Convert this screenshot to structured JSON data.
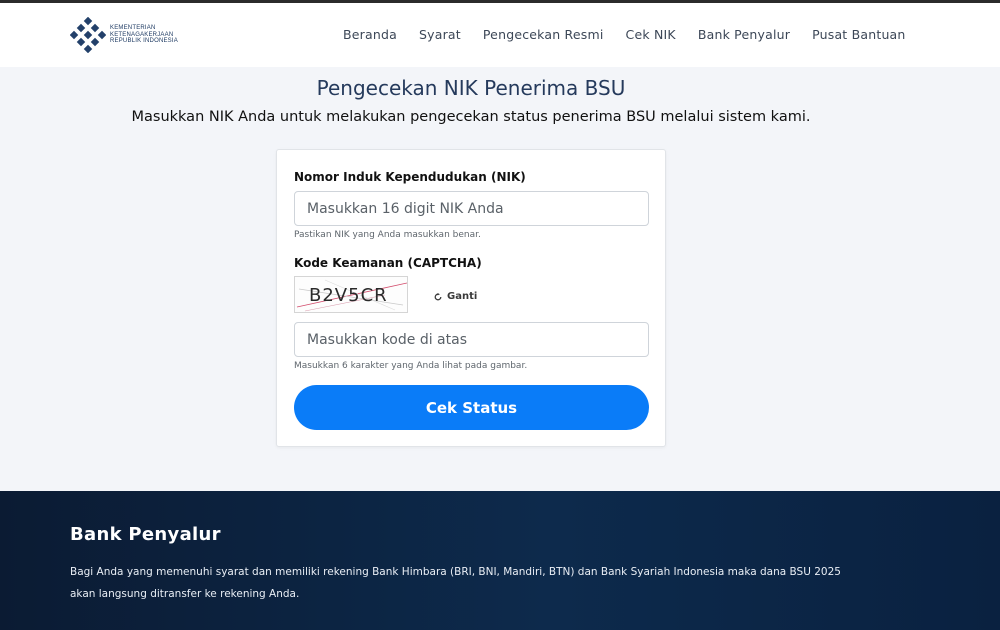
{
  "header": {
    "logo": {
      "lines": [
        "KEMENTERIAN",
        "KETENAGAKERJAAN",
        "REPUBLIK INDONESIA"
      ],
      "icon": "ministry-logo-icon"
    },
    "nav": [
      "Beranda",
      "Syarat",
      "Pengecekan Resmi",
      "Cek NIK",
      "Bank Penyalur",
      "Pusat Bantuan"
    ]
  },
  "main": {
    "title": "Pengecekan NIK Penerima BSU",
    "subtitle": "Masukkan NIK Anda untuk melakukan pengecekan status penerima BSU melalui sistem kami."
  },
  "form": {
    "nik_label": "Nomor Induk Kependudukan (NIK)",
    "nik_placeholder": "Masukkan 16 digit NIK Anda",
    "nik_value": "",
    "nik_hint": "Pastikan NIK yang Anda masukkan benar.",
    "captcha_label": "Kode Keamanan (CAPTCHA)",
    "captcha_code": "B2V5CR",
    "refresh_label": "Ganti",
    "refresh_icon": "refresh-icon",
    "captcha_placeholder": "Masukkan kode di atas",
    "captcha_value": "",
    "captcha_hint": "Masukkan 6 karakter yang Anda lihat pada gambar.",
    "submit_label": "Cek Status"
  },
  "footer": {
    "title": "Bank Penyalur",
    "text": "Bagi Anda yang memenuhi syarat dan memiliki rekening Bank Himbara (BRI, BNI, Mandiri, BTN) dan Bank Syariah Indonesia maka dana BSU 2025 akan langsung ditransfer ke rekening Anda."
  },
  "colors": {
    "primary_button": "#0a7cf8",
    "title": "#253a5c",
    "footer_bg": "#0d2a4c",
    "page_bg": "#f3f5f9"
  }
}
